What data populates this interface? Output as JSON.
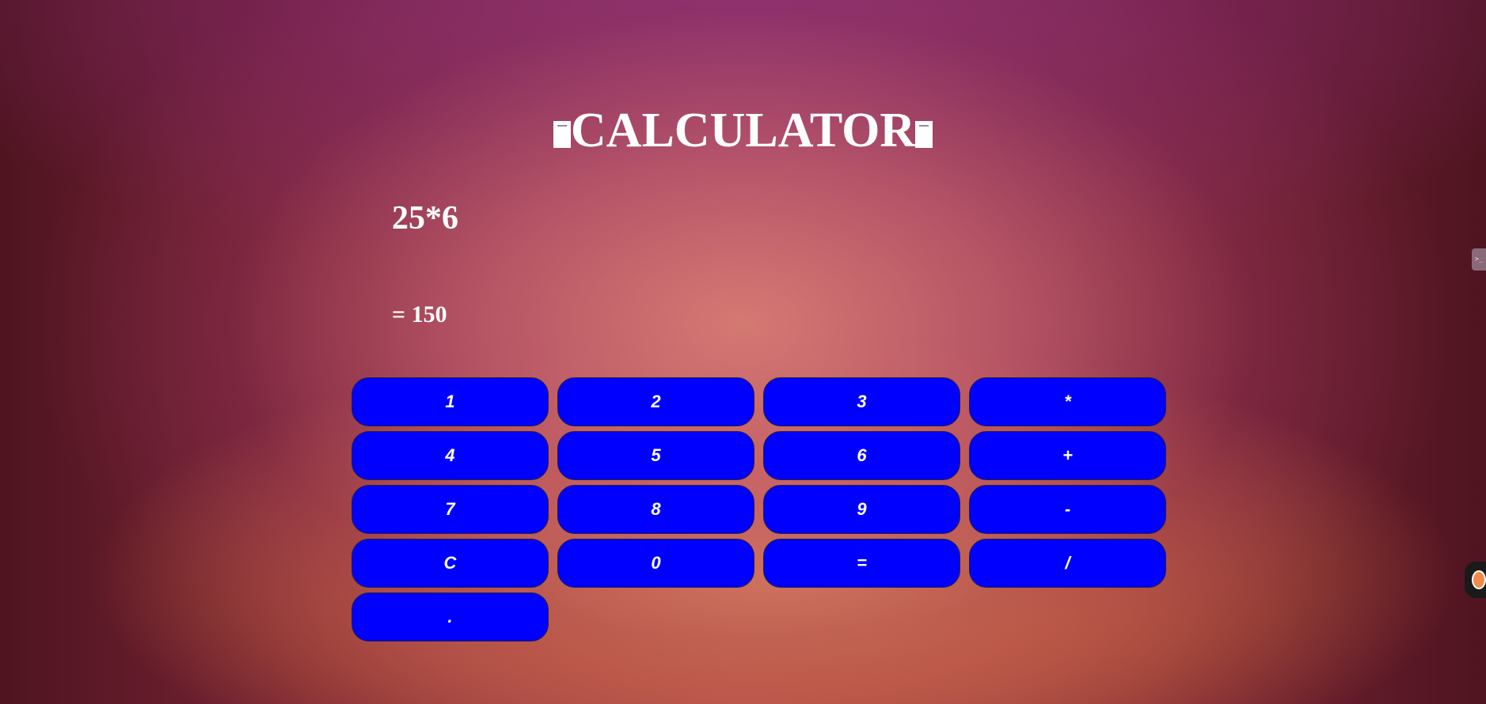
{
  "title": {
    "text": "CALCULATOR",
    "decoration_icon": "clipboard-icon"
  },
  "display": {
    "expression": "25*6",
    "result": "= 150"
  },
  "keypad": {
    "keys": [
      "1",
      "2",
      "3",
      "*",
      "4",
      "5",
      "6",
      "+",
      "7",
      "8",
      "9",
      "-",
      "C",
      "0",
      "=",
      "/",
      "."
    ]
  },
  "side_tab": {
    "icon": "terminal-icon",
    "glyph": ">_"
  },
  "side_widget": {
    "icon": "extension-logo-icon"
  },
  "colors": {
    "button_bg": "#0000ff",
    "text": "#ffffff"
  }
}
